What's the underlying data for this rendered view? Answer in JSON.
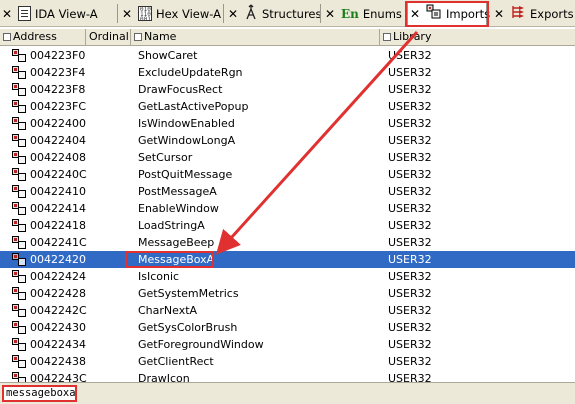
{
  "tabs": [
    {
      "label": "IDA View-A",
      "icon": "document-icon",
      "active": false
    },
    {
      "label": "Hex View-A",
      "icon": "hex-icon",
      "active": false
    },
    {
      "label": "Structures",
      "icon": "structures-icon",
      "active": false
    },
    {
      "label": "Enums",
      "icon": "enums-icon",
      "active": false
    },
    {
      "label": "Imports",
      "icon": "imports-icon",
      "active": true
    },
    {
      "label": "Exports",
      "icon": "exports-icon",
      "active": false
    }
  ],
  "enum_glyph": "En",
  "columns": [
    "Address",
    "Ordinal",
    "Name",
    "Library"
  ],
  "rows": [
    {
      "address": "004223F0",
      "ordinal": "",
      "name": "ShowCaret",
      "library": "USER32"
    },
    {
      "address": "004223F4",
      "ordinal": "",
      "name": "ExcludeUpdateRgn",
      "library": "USER32"
    },
    {
      "address": "004223F8",
      "ordinal": "",
      "name": "DrawFocusRect",
      "library": "USER32"
    },
    {
      "address": "004223FC",
      "ordinal": "",
      "name": "GetLastActivePopup",
      "library": "USER32"
    },
    {
      "address": "00422400",
      "ordinal": "",
      "name": "IsWindowEnabled",
      "library": "USER32"
    },
    {
      "address": "00422404",
      "ordinal": "",
      "name": "GetWindowLongA",
      "library": "USER32"
    },
    {
      "address": "00422408",
      "ordinal": "",
      "name": "SetCursor",
      "library": "USER32"
    },
    {
      "address": "0042240C",
      "ordinal": "",
      "name": "PostQuitMessage",
      "library": "USER32"
    },
    {
      "address": "00422410",
      "ordinal": "",
      "name": "PostMessageA",
      "library": "USER32"
    },
    {
      "address": "00422414",
      "ordinal": "",
      "name": "EnableWindow",
      "library": "USER32"
    },
    {
      "address": "00422418",
      "ordinal": "",
      "name": "LoadStringA",
      "library": "USER32"
    },
    {
      "address": "0042241C",
      "ordinal": "",
      "name": "MessageBeep",
      "library": "USER32"
    },
    {
      "address": "00422420",
      "ordinal": "",
      "name": "MessageBoxA",
      "library": "USER32",
      "selected": true
    },
    {
      "address": "00422424",
      "ordinal": "",
      "name": "IsIconic",
      "library": "USER32"
    },
    {
      "address": "00422428",
      "ordinal": "",
      "name": "GetSystemMetrics",
      "library": "USER32"
    },
    {
      "address": "0042242C",
      "ordinal": "",
      "name": "CharNextA",
      "library": "USER32"
    },
    {
      "address": "00422430",
      "ordinal": "",
      "name": "GetSysColorBrush",
      "library": "USER32"
    },
    {
      "address": "00422434",
      "ordinal": "",
      "name": "GetForegroundWindow",
      "library": "USER32"
    },
    {
      "address": "00422438",
      "ordinal": "",
      "name": "GetClientRect",
      "library": "USER32"
    },
    {
      "address": "0042243C",
      "ordinal": "",
      "name": "DrawIcon",
      "library": "USER32"
    }
  ],
  "search": {
    "value": "messageboxa"
  },
  "colors": {
    "selection": "#316ac5",
    "highlight_annotation": "#e03030",
    "chrome": "#ece9d8"
  }
}
